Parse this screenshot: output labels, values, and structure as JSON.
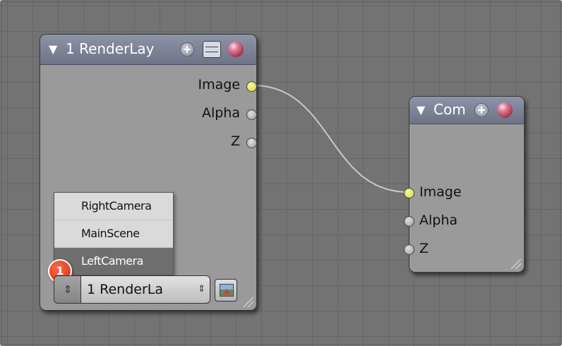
{
  "render_layers_node": {
    "title": "1 RenderLay",
    "collapse_glyph": "▼",
    "icons": [
      "plus-icon",
      "collapse-icon",
      "sphere-icon"
    ],
    "outputs": [
      "Image",
      "Alpha",
      "Z"
    ],
    "layer_menu": {
      "options": [
        "RightCamera",
        "MainScene",
        "LeftCamera"
      ],
      "highlighted": "LeftCamera"
    },
    "badge": "1",
    "layer_field": {
      "spin_glyph": "⇕",
      "value": "1 RenderLa",
      "updown_glyph": "⇕",
      "browse_icon": "image-icon"
    }
  },
  "composite_node": {
    "title": "Com",
    "collapse_glyph": "▼",
    "icons": [
      "plus-icon",
      "sphere-icon"
    ],
    "inputs": [
      "Image",
      "Alpha",
      "Z"
    ]
  },
  "link": {
    "from": "render_layers_node.outputs.0",
    "to": "composite_node.inputs.0",
    "color": "#c8c8c8"
  },
  "colors": {
    "editor_background": "#737373",
    "node_body": "#9a9a9a",
    "node_header": "#7a7f92",
    "socket_image": "#d8d83a",
    "socket_default": "#bfbfbf",
    "menu_highlight": "#6e6e6e",
    "badge": "#d42a10"
  }
}
